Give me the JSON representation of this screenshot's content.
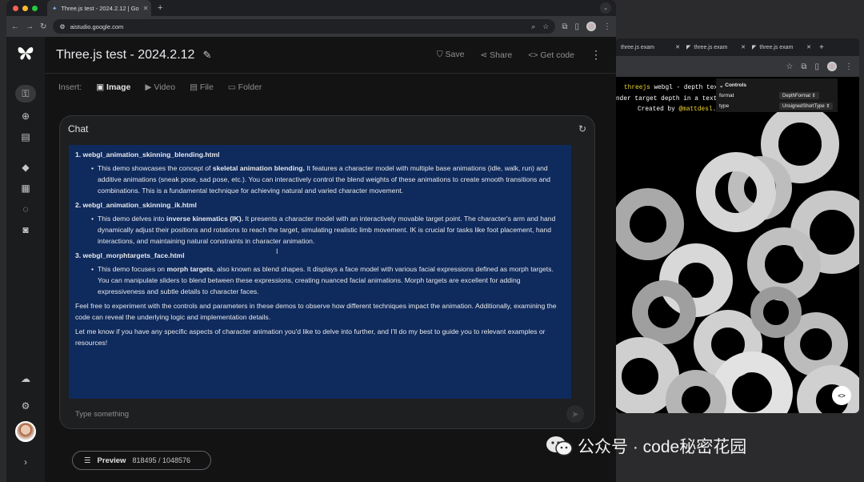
{
  "browser": {
    "tab_title": "Three.js test - 2024.2.12 | Go",
    "url": "aistudio.google.com"
  },
  "app": {
    "title": "Three.js test - 2024.2.12",
    "actions": {
      "save": "Save",
      "share": "Share",
      "get_code": "Get code"
    }
  },
  "insert": {
    "label": "Insert:",
    "items": [
      "Image",
      "Video",
      "File",
      "Folder"
    ]
  },
  "chat": {
    "header": "Chat",
    "sections": [
      {
        "title": "1. webgl_animation_skinning_blending.html",
        "pre": "This demo showcases the concept of ",
        "bold": "skeletal animation blending.",
        "post": " It features a character model with multiple base animations (idle, walk, run) and additive animations (sneak pose, sad pose, etc.). You can interactively control the blend weights of these animations to create smooth transitions and combinations. This is a fundamental technique for achieving natural and varied character movement."
      },
      {
        "title": "2. webgl_animation_skinning_ik.html",
        "pre": "This demo delves into ",
        "bold": "inverse kinematics (IK).",
        "post": " It presents a character model with an interactively movable target point. The character's arm and hand dynamically adjust their positions and rotations to reach the target, simulating realistic limb movement. IK is crucial for tasks like foot placement, hand interactions, and maintaining natural constraints in character animation."
      },
      {
        "title": "3. webgl_morphtargets_face.html",
        "pre": "This demo focuses on ",
        "bold": "morph targets",
        "post": ", also known as blend shapes. It displays a face model with various facial expressions defined as morph targets. You can manipulate sliders to blend between these expressions, creating nuanced facial animations. Morph targets are excellent for adding expressiveness and subtle details to character faces."
      }
    ],
    "closing": [
      "Feel free to experiment with the controls and parameters in these demos to observe how different techniques impact the animation. Additionally, examining the code can reveal the underlying logic and implementation details.",
      "Let me know if you have any specific aspects of character animation you'd like to delve into further, and I'll do my best to guide you to relevant examples or resources!"
    ],
    "input_placeholder": "Type something"
  },
  "preview": {
    "label": "Preview",
    "tokens": "818495 / 1048576"
  },
  "preview_window": {
    "tabs": [
      "three.js exam",
      "three.js exam",
      "three.js exam"
    ],
    "info_line1_a": "threejs",
    "info_line1_b": " webgl - depth textu",
    "info_line2": "nder target depth in a textur",
    "info_line3_a": "Created by ",
    "info_line3_b": "@mattdesl",
    "info_line3_c": ".",
    "controls_title": "Controls",
    "controls": [
      {
        "key": "format",
        "value": "DepthFormat"
      },
      {
        "key": "type",
        "value": "UnsignedShortType"
      }
    ]
  },
  "watermark": "公众号 · code秘密花园",
  "colors": {
    "message_bg": "#0f2a5c",
    "app_bg": "#131314",
    "accent_yellow": "#f0d72f"
  }
}
